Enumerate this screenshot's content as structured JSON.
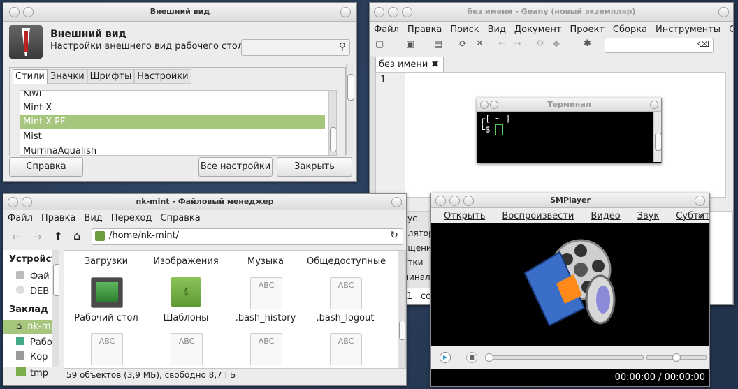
{
  "appearance": {
    "title": "Внешний вид",
    "heading": "Внешний вид",
    "subtitle": "Настройки внешнего вид рабочего стола",
    "tabs": [
      "Стили",
      "Значки",
      "Шрифты",
      "Настройки"
    ],
    "themes": [
      "Kiwi",
      "Mint-X",
      "Mint-X-PF",
      "Mist",
      "MurrinaAqualish"
    ],
    "buttons": {
      "help": "Справка",
      "all_settings": "Все настройки",
      "close": "Закрыть"
    }
  },
  "geany": {
    "title": "без имени - Geany (новый экземпляр)",
    "menu": [
      "Файл",
      "Правка",
      "Поиск",
      "Вид",
      "Документ",
      "Проект",
      "Сборка",
      "Инструменты",
      "Справка"
    ],
    "tab": "без имени",
    "line": "1",
    "bottom_tabs": [
      "тус",
      "илятор",
      "бщения",
      "етки",
      "минал"
    ],
    "bottom_line": "1",
    "bottom_text": "со"
  },
  "terminal": {
    "title": "Терминал",
    "line1": "┌[ ~ ]",
    "line2": "└$"
  },
  "filemanager": {
    "title": "nk-mint - Файловый менеджер",
    "menu": [
      "Файл",
      "Правка",
      "Вид",
      "Переход",
      "Справка"
    ],
    "path": "/home/nk-mint/",
    "sidebar": {
      "devices_header": "Устройст",
      "devices": [
        "Фай",
        "DEB"
      ],
      "bookmarks_header": "Заклад",
      "bookmarks": [
        "nk-m",
        "Рабо",
        "Кор",
        "tmp"
      ]
    },
    "row1": [
      "Загрузки",
      "Изображения",
      "Музыка",
      "Общедоступные"
    ],
    "row2": [
      "Рабочий стол",
      "Шаблоны",
      ".bash_history",
      ".bash_logout"
    ],
    "abc": "ABC",
    "status": "59 объектов (3,9 МБ), свободно 8,7 ГБ"
  },
  "smplayer": {
    "title": "SMPlayer",
    "menu": [
      "Открыть",
      "Воспроизвести",
      "Видео",
      "Звук",
      "Субтитры"
    ],
    "more": "»",
    "time": "00:00:00 / 00:00:00"
  }
}
